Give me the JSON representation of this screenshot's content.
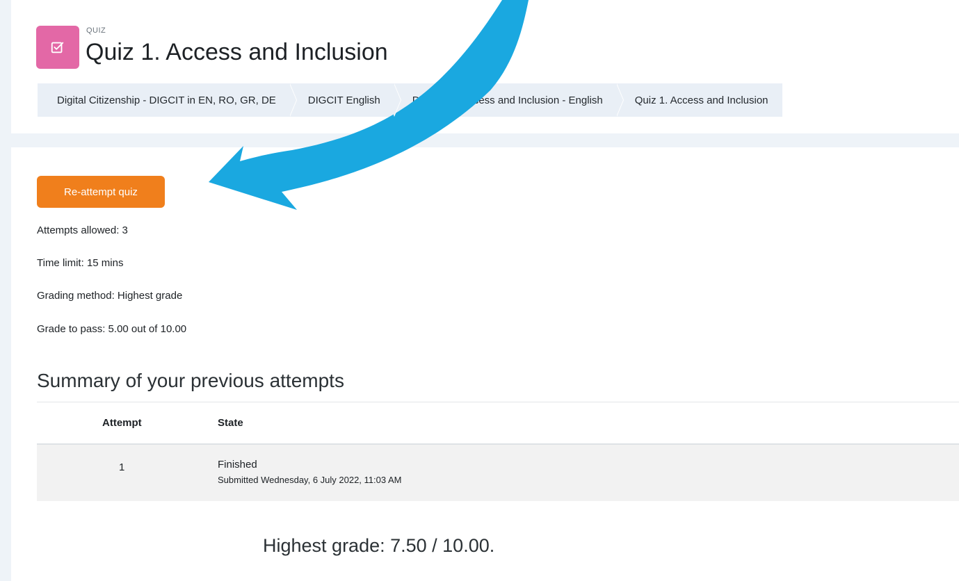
{
  "header": {
    "activity_type": "QUIZ",
    "title": "Quiz 1. Access and Inclusion"
  },
  "breadcrumb": [
    {
      "label": "Digital Citizenship - DIGCIT in EN, RO, GR, DE"
    },
    {
      "label": "DIGCIT English"
    },
    {
      "label": "DIGCIT 1. Access and Inclusion - English"
    },
    {
      "label": "Quiz 1. Access and Inclusion"
    }
  ],
  "quiz": {
    "reattempt_label": "Re-attempt quiz",
    "attempts_allowed": "Attempts allowed: 3",
    "time_limit": "Time limit: 15 mins",
    "grading_method": "Grading method: Highest grade",
    "grade_to_pass": "Grade to pass: 5.00 out of 10.00"
  },
  "summary": {
    "title": "Summary of your previous attempts",
    "columns": {
      "attempt": "Attempt",
      "state": "State"
    },
    "rows": [
      {
        "attempt": "1",
        "state": "Finished",
        "submitted": "Submitted Wednesday, 6 July 2022, 11:03 AM"
      }
    ],
    "highest_grade": "Highest grade: 7.50 / 10.00."
  },
  "colors": {
    "accent_orange": "#f07f1c",
    "quiz_icon_pink": "#e368a6",
    "annotation_arrow": "#1aa8e0"
  },
  "icons": {
    "activity": "checkbox-edit-icon",
    "annotation": "arrow-annotation"
  }
}
